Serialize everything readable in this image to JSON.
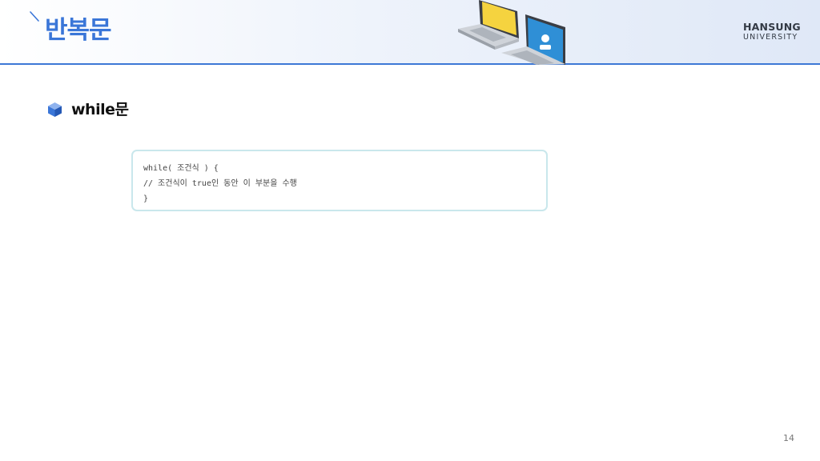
{
  "header": {
    "title": "반복문",
    "logo_line1": "HANSUNG",
    "logo_line2": "UNIVERSITY"
  },
  "content": {
    "bullet": "while문",
    "code_lines": [
      "while( 조건식 ) {",
      "// 조건식이 true인 동안 이 부분을 수행",
      "}"
    ]
  },
  "footer": {
    "page_number": "14"
  },
  "colors": {
    "accent": "#3a76d8",
    "header_rule": "#3d78d6",
    "code_border": "#c9e7ec",
    "laptop_yellow": "#f5d33f",
    "laptop_blue": "#2f8fd6"
  },
  "icons": {
    "bullet": "cube-icon",
    "illustration": "laptops-illustration",
    "title_marker": "tick-mark"
  }
}
